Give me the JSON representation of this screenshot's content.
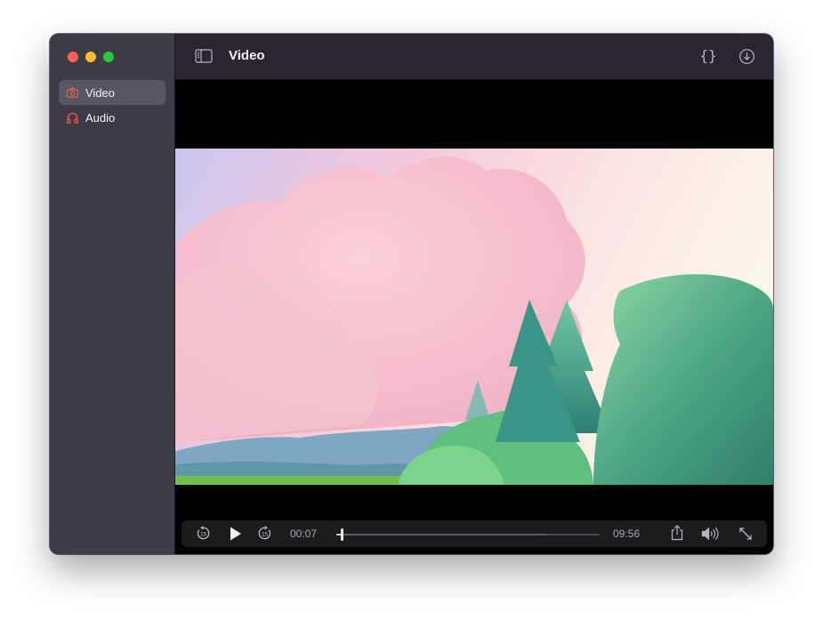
{
  "window": {
    "title": "Video",
    "traffic_lights": {
      "close": "#fe5f57",
      "minimize": "#febc2e",
      "maximize": "#28c840"
    }
  },
  "sidebar": {
    "items": [
      {
        "label": "Video",
        "icon": "camera-icon",
        "active": true
      },
      {
        "label": "Audio",
        "icon": "headphones-icon",
        "active": false
      }
    ],
    "accent": "#ff5a52"
  },
  "toolbar": {
    "title": "Video",
    "json_label": "{}",
    "icons": [
      "sidebar-toggle-icon",
      "braces-icon",
      "download-icon"
    ]
  },
  "player": {
    "current_time": "00:07",
    "duration": "09:56",
    "progress": 0.02,
    "buffered": 0.8,
    "skip_back_label": "15",
    "skip_forward_label": "15"
  }
}
